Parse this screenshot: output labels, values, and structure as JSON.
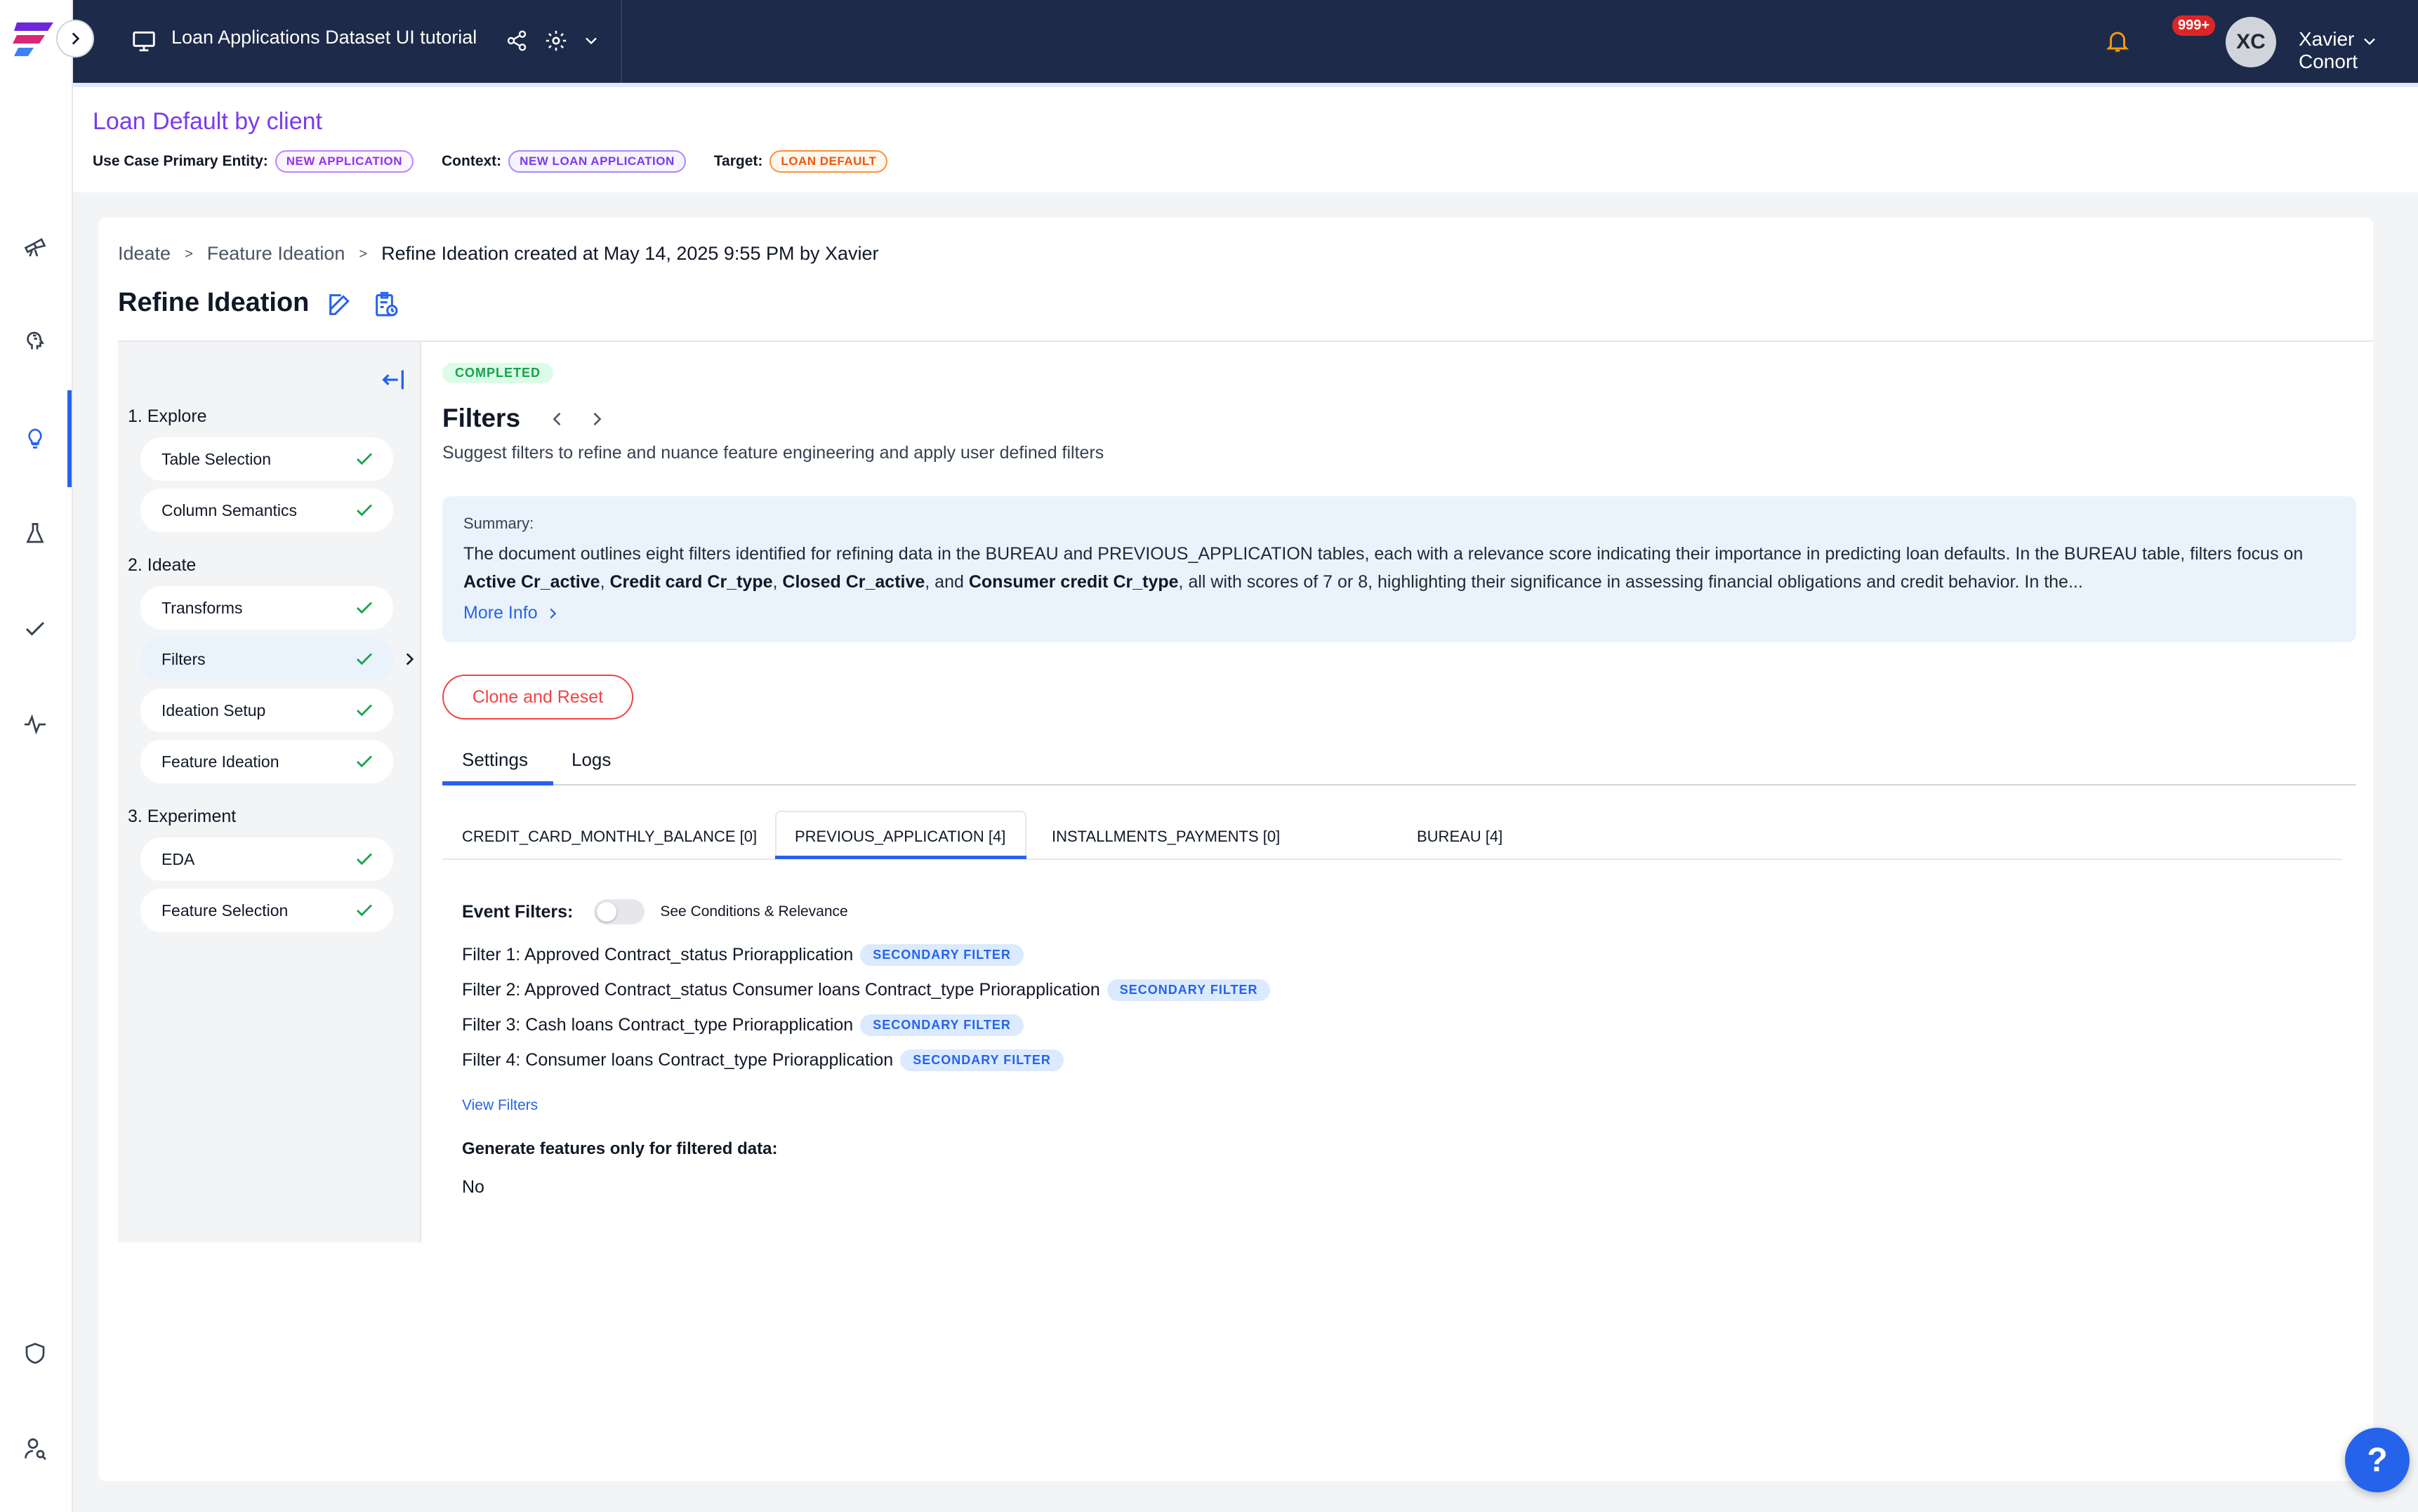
{
  "topbar": {
    "title": "Loan Applications Dataset UI tutorial",
    "notification_count": "999+",
    "avatar_initials": "XC",
    "username": "Xavier Conort"
  },
  "usecase": {
    "title": "Loan Default by client",
    "primary_entity_label": "Use Case Primary Entity:",
    "primary_entity_value": "NEW APPLICATION",
    "context_label": "Context:",
    "context_value": "NEW LOAN APPLICATION",
    "target_label": "Target:",
    "target_value": "LOAN DEFAULT"
  },
  "breadcrumb": {
    "items": [
      "Ideate",
      "Feature Ideation",
      "Refine Ideation created at May 14, 2025 9:55 PM by Xavier"
    ],
    "separator": ">"
  },
  "page": {
    "title": "Refine Ideation"
  },
  "steps": {
    "sections": [
      {
        "label": "1. Explore",
        "items": [
          "Table Selection",
          "Column Semantics"
        ]
      },
      {
        "label": "2. Ideate",
        "items": [
          "Transforms",
          "Filters",
          "Ideation Setup",
          "Feature Ideation"
        ]
      },
      {
        "label": "3. Experiment",
        "items": [
          "EDA",
          "Feature Selection"
        ]
      }
    ]
  },
  "content": {
    "status": "COMPLETED",
    "title": "Filters",
    "subtitle": "Suggest filters to refine and nuance feature engineering and apply user defined filters",
    "summary_label": "Summary:",
    "summary_p1": "The document outlines eight filters identified for refining data in the BUREAU and PREVIOUS_APPLICATION tables, each with a relevance score indicating their importance in predicting loan defaults. In the BUREAU table, filters focus on ",
    "summary_b1": "Active Cr_active",
    "summary_b2": "Credit card Cr_type",
    "summary_b3": "Closed Cr_active",
    "summary_and": ", and ",
    "summary_b4": "Consumer credit Cr_type",
    "summary_p2": ", all with scores of 7 or 8, highlighting their significance in assessing financial obligations and credit behavior. In the...",
    "more_info": "More Info",
    "clone_button": "Clone and Reset",
    "tabs": [
      "Settings",
      "Logs"
    ],
    "subtabs": [
      "CREDIT_CARD_MONTHLY_BALANCE [0]",
      "PREVIOUS_APPLICATION [4]",
      "INSTALLMENTS_PAYMENTS [0]",
      "BUREAU [4]"
    ],
    "event_filters_label": "Event Filters:",
    "see_conditions": "See Conditions & Relevance",
    "filters": [
      {
        "text": "Filter 1: Approved Contract_status Priorapplication",
        "badge": "SECONDARY FILTER"
      },
      {
        "text": "Filter 2: Approved Contract_status Consumer loans Contract_type Priorapplication",
        "badge": "SECONDARY FILTER"
      },
      {
        "text": "Filter 3: Cash loans Contract_type Priorapplication",
        "badge": "SECONDARY FILTER"
      },
      {
        "text": "Filter 4: Consumer loans Contract_type Priorapplication",
        "badge": "SECONDARY FILTER"
      }
    ],
    "view_filters": "View Filters",
    "generate_label": "Generate features only for filtered data:",
    "generate_value": "No"
  },
  "help": {
    "label": "?"
  },
  "colors": {
    "primary": "#2563eb",
    "topbar": "#1e2a4a",
    "accent_purple": "#7c3aed",
    "success": "#16a34a",
    "danger": "#ef4444"
  }
}
